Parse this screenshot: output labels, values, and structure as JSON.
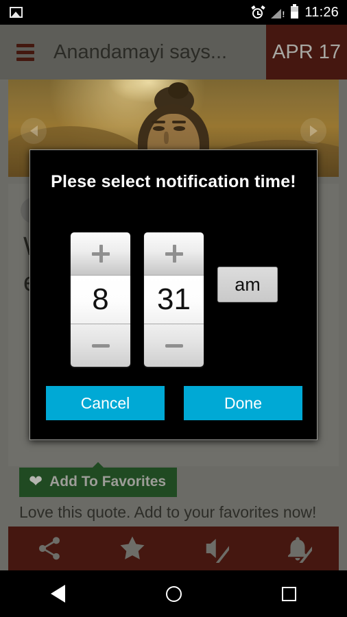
{
  "status_bar": {
    "time": "11:26",
    "icons": [
      "image-icon",
      "alarm-icon",
      "signal-warning-icon",
      "battery-icon"
    ]
  },
  "app_bar": {
    "menu_icon": "hamburger-icon",
    "title": "Anandamayi says...",
    "date_badge": "APR 17",
    "bg_color": "#451710"
  },
  "content": {
    "carousel": {
      "prev_icon": "chevron-left-icon",
      "next_icon": "chevron-right-icon"
    },
    "quote_mark": "“",
    "quote_text": "W... t... i... y... r... W... c. every heart.",
    "favorites": {
      "heart_icon": "heart-icon",
      "label": "Add To Favorites",
      "subtitle": "Love this quote. Add to your favorites now!",
      "bg_color": "#204a22"
    },
    "toolbar": [
      {
        "name": "share-icon",
        "label": "Share"
      },
      {
        "name": "star-icon",
        "label": "Favorite"
      },
      {
        "name": "volume-off-icon",
        "label": "Mute sound"
      },
      {
        "name": "notifications-off-icon",
        "label": "Mute notifications"
      }
    ]
  },
  "dialog": {
    "title": "Plese select notification time!",
    "hour": {
      "increment_label": "+",
      "value": "8",
      "decrement_label": "–"
    },
    "minute": {
      "increment_label": "+",
      "value": "31",
      "decrement_label": "–"
    },
    "meridiem": "am",
    "cancel_label": "Cancel",
    "done_label": "Done",
    "accent_color": "#00A9D5",
    "bg_color": "#000000"
  },
  "nav_bar": {
    "back": "back-triangle-icon",
    "home": "home-circle-icon",
    "recents": "recents-square-icon"
  }
}
